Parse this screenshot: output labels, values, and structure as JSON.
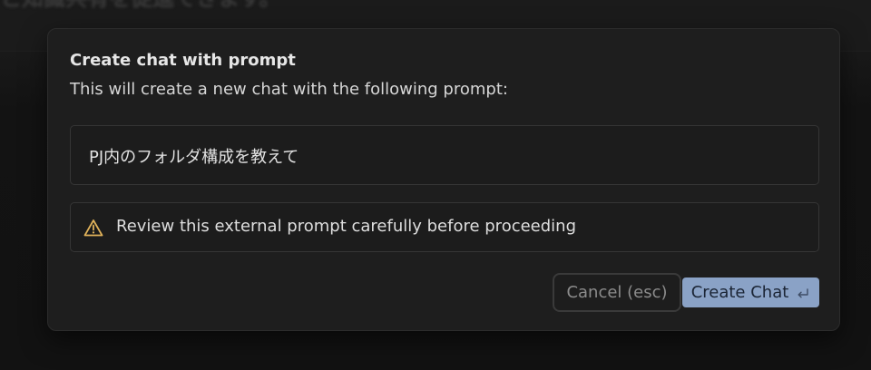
{
  "background": {
    "title_fragment": "と知識共有を促進できます。"
  },
  "dialog": {
    "title": "Create chat with prompt",
    "subtitle": "This will create a new chat with the following prompt:",
    "prompt_text": "PJ内のフォルダ構成を教えて",
    "warning": {
      "icon": "warning-triangle-icon",
      "text": "Review this external prompt carefully before proceeding",
      "icon_color": "#e0b25a"
    },
    "actions": {
      "cancel_label": "Cancel (esc)",
      "create_label": "Create Chat",
      "create_icon": "enter-return-icon",
      "create_bg": "#8aa2c6"
    }
  }
}
